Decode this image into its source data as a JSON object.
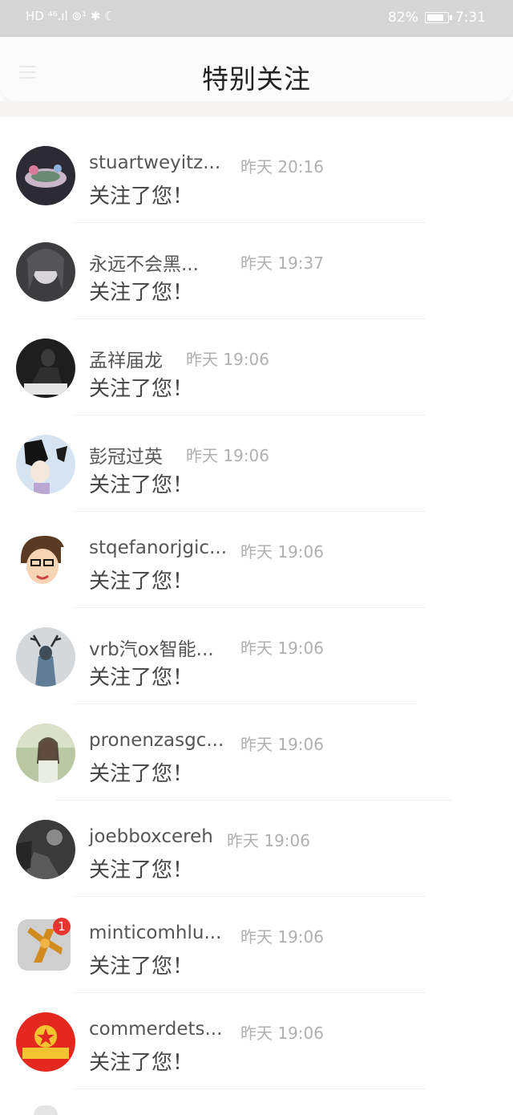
{
  "status_bar": {
    "left_indicators": "HD ⁴⁶.ıl ⊚¹ ✱ ☾",
    "battery_percent": "82%",
    "battery_level": 0.82,
    "time": "7:31"
  },
  "header": {
    "title": "特别关注",
    "menu_icon": "menu-icon"
  },
  "notifications": [
    {
      "name": "stuartweyitz...",
      "time": "昨天 20:16",
      "message": "关注了您！",
      "avatar": "avatar-teacup"
    },
    {
      "name": "永远不会黑...",
      "time": "昨天 19:37",
      "message": "关注了您！",
      "avatar": "avatar-anime-girl"
    },
    {
      "name": "孟祥届龙",
      "time": "昨天 19:06",
      "message": "关注了您！",
      "avatar": "avatar-dark-figure"
    },
    {
      "name": "彭冠过英",
      "time": "昨天 19:06",
      "message": "关注了您！",
      "avatar": "avatar-manga"
    },
    {
      "name": "stqefanorjgic...",
      "time": "昨天 19:06",
      "message": "关注了您！",
      "avatar": "avatar-cartoon-face"
    },
    {
      "name": "vrb汽ox智能...",
      "time": "昨天 19:06",
      "message": "关注了您！",
      "avatar": "avatar-antlers"
    },
    {
      "name": "pronenzasgc...",
      "time": "昨天 19:06",
      "message": "关注了您！",
      "avatar": "avatar-girl-photo"
    },
    {
      "name": "joebboxcereh",
      "time": "昨天 19:06",
      "message": "关注了您！",
      "avatar": "avatar-bw-photo"
    },
    {
      "name": "minticomhlu...",
      "time": "昨天 19:06",
      "message": "关注了您！",
      "avatar": "avatar-app-icon",
      "badge": "1"
    },
    {
      "name": "commerdets...",
      "time": "昨天 19:06",
      "message": "关注了您！",
      "avatar": "avatar-emblem"
    }
  ]
}
